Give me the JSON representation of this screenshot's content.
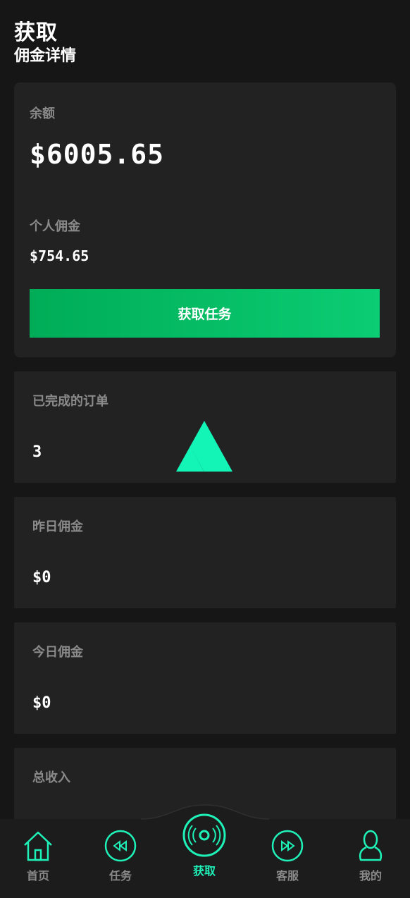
{
  "header": {
    "title": "获取",
    "subtitle": "佣金详情"
  },
  "balance_card": {
    "balance_label": "余额",
    "balance_value": "$6005.65",
    "commission_label": "个人佣金",
    "commission_value": "$754.65",
    "task_button_label": "获取任务"
  },
  "stats": [
    {
      "label": "已完成的订单",
      "value": "3"
    },
    {
      "label": "昨日佣金",
      "value": "$0"
    },
    {
      "label": "今日佣金",
      "value": "$0"
    },
    {
      "label": "总收入",
      "value": ""
    }
  ],
  "bottom_nav": {
    "items": [
      {
        "label": "首页",
        "icon": "home-icon"
      },
      {
        "label": "任务",
        "icon": "rewind-icon"
      },
      {
        "label": "获取",
        "icon": "disc-icon",
        "active": true
      },
      {
        "label": "客服",
        "icon": "fast-forward-icon"
      },
      {
        "label": "我的",
        "icon": "user-icon"
      }
    ]
  },
  "colors": {
    "accent": "#1ef2b8",
    "button_start": "#00ac57",
    "button_end": "#0bcd73",
    "card_bg": "#222222",
    "page_bg": "#161616"
  }
}
